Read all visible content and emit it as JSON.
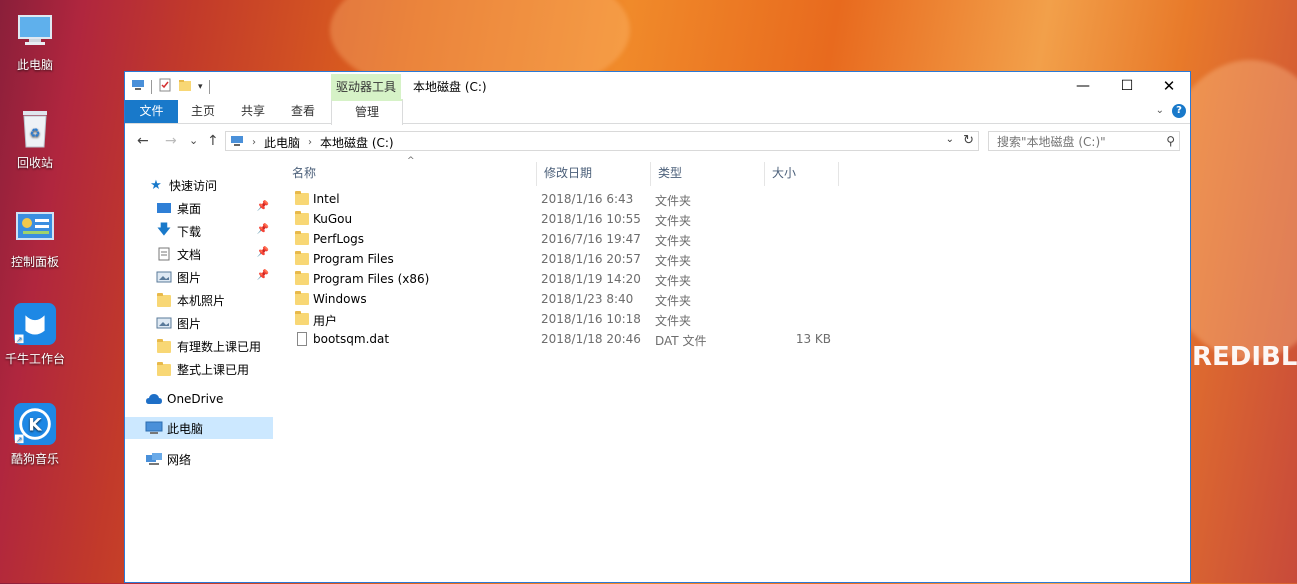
{
  "desktop": {
    "icons": [
      {
        "label": "此电脑",
        "icon": "computer-icon"
      },
      {
        "label": "回收站",
        "icon": "recycle-bin-icon"
      },
      {
        "label": "控制面板",
        "icon": "control-panel-icon"
      },
      {
        "label": "千牛工作台",
        "icon": "qianniu-icon"
      },
      {
        "label": "酷狗音乐",
        "icon": "kugou-icon"
      }
    ],
    "wallpaper_text": "REDIBLE"
  },
  "window": {
    "title": "本地磁盘 (C:)",
    "context_tab_group": "驱动器工具",
    "controls": {
      "minimize": "—",
      "maximize": "☐",
      "close": "✕"
    },
    "ribbon_tabs": [
      "文件",
      "主页",
      "共享",
      "查看",
      "管理"
    ],
    "help": "?"
  },
  "navigation": {
    "back": "←",
    "forward": "→",
    "recent": "⌄",
    "up": "↑",
    "breadcrumb": [
      "此电脑",
      "本地磁盘 (C:)"
    ],
    "search_placeholder": "搜索\"本地磁盘 (C:)\""
  },
  "sidebar": {
    "items": [
      {
        "label": "快速访问",
        "icon": "star-icon",
        "pinned": false
      },
      {
        "label": "桌面",
        "icon": "desktop-icon",
        "pinned": true
      },
      {
        "label": "下载",
        "icon": "download-icon",
        "pinned": true
      },
      {
        "label": "文档",
        "icon": "document-icon",
        "pinned": true
      },
      {
        "label": "图片",
        "icon": "picture-icon",
        "pinned": true
      },
      {
        "label": "本机照片",
        "icon": "folder-icon",
        "pinned": false
      },
      {
        "label": "图片",
        "icon": "picture-icon",
        "pinned": false
      },
      {
        "label": "有理数上课已用",
        "icon": "folder-icon",
        "pinned": false
      },
      {
        "label": "整式上课已用",
        "icon": "folder-icon",
        "pinned": false
      },
      {
        "label": "OneDrive",
        "icon": "cloud-icon",
        "pinned": false
      },
      {
        "label": "此电脑",
        "icon": "computer-icon",
        "pinned": false,
        "selected": true
      },
      {
        "label": "网络",
        "icon": "network-icon",
        "pinned": false
      }
    ]
  },
  "list": {
    "columns": [
      "名称",
      "修改日期",
      "类型",
      "大小"
    ],
    "files": [
      {
        "name": "Intel",
        "modified": "2018/1/16 6:43",
        "type": "文件夹",
        "size": "",
        "kind": "folder"
      },
      {
        "name": "KuGou",
        "modified": "2018/1/16 10:55",
        "type": "文件夹",
        "size": "",
        "kind": "folder"
      },
      {
        "name": "PerfLogs",
        "modified": "2016/7/16 19:47",
        "type": "文件夹",
        "size": "",
        "kind": "folder"
      },
      {
        "name": "Program Files",
        "modified": "2018/1/16 20:57",
        "type": "文件夹",
        "size": "",
        "kind": "folder"
      },
      {
        "name": "Program Files (x86)",
        "modified": "2018/1/19 14:20",
        "type": "文件夹",
        "size": "",
        "kind": "folder"
      },
      {
        "name": "Windows",
        "modified": "2018/1/23 8:40",
        "type": "文件夹",
        "size": "",
        "kind": "folder"
      },
      {
        "name": "用户",
        "modified": "2018/1/16 10:18",
        "type": "文件夹",
        "size": "",
        "kind": "folder"
      },
      {
        "name": "bootsqm.dat",
        "modified": "2018/1/18 20:46",
        "type": "DAT 文件",
        "size": "13 KB",
        "kind": "file"
      }
    ]
  },
  "colors": {
    "accent": "#1979ca",
    "context_tab": "#d6f2c7",
    "selection": "#cce8ff",
    "folder": "#f8d775"
  }
}
